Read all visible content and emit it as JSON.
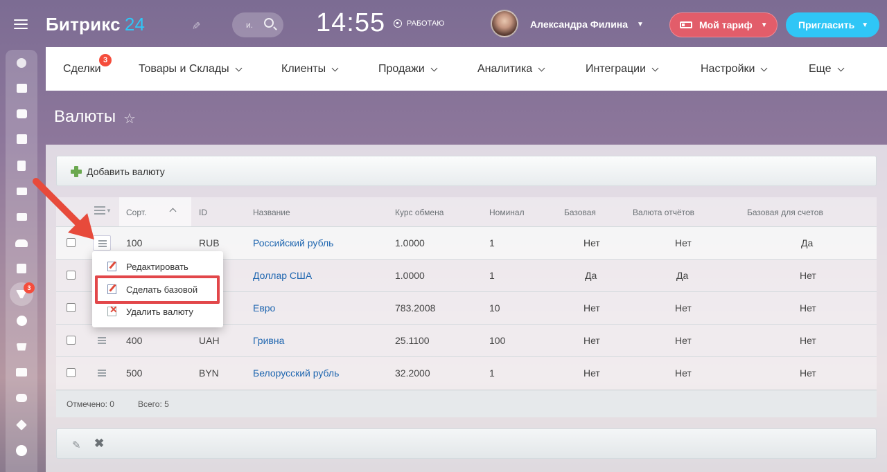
{
  "header": {
    "logo_text": "Битрикс",
    "logo_num": "24",
    "search_placeholder": "и.",
    "clock": "14:55",
    "work_status": "РАБОТАЮ",
    "user_name": "Александра Филина",
    "tariff_button": "Мой тариф",
    "invite_button": "Пригласить"
  },
  "left_rail": {
    "badge_filter": "3",
    "icons": [
      "pulse-icon",
      "feed-icon",
      "chat-icon",
      "calendar-icon",
      "docs-icon",
      "drive-icon",
      "mail-icon",
      "users-icon",
      "tasks-icon",
      "crm-filter-icon",
      "target-icon",
      "cart-icon",
      "contacts-icon",
      "robot-icon",
      "box-icon",
      "more-icon"
    ]
  },
  "nav": {
    "items": [
      {
        "label": "Сделки",
        "badge": "3"
      },
      {
        "label": "Товары и Склады"
      },
      {
        "label": "Клиенты"
      },
      {
        "label": "Продажи"
      },
      {
        "label": "Аналитика"
      },
      {
        "label": "Интеграции"
      },
      {
        "label": "Настройки"
      },
      {
        "label": "Еще"
      }
    ]
  },
  "page": {
    "title": "Валюты",
    "add_button": "Добавить валюту"
  },
  "table": {
    "columns": [
      "Сорт.",
      "ID",
      "Название",
      "Курс обмена",
      "Номинал",
      "Базовая",
      "Валюта отчётов",
      "Базовая для счетов"
    ],
    "rows": [
      {
        "sort": "100",
        "id": "RUB",
        "name": "Российский рубль",
        "rate": "1.0000",
        "nominal": "1",
        "base": "Нет",
        "report": "Нет",
        "invoice_base": "Да"
      },
      {
        "sort": "",
        "id": "",
        "name": "Доллар США",
        "rate": "1.0000",
        "nominal": "1",
        "base": "Да",
        "report": "Да",
        "invoice_base": "Нет"
      },
      {
        "sort": "",
        "id": "",
        "name": "Евро",
        "rate": "783.2008",
        "nominal": "10",
        "base": "Нет",
        "report": "Нет",
        "invoice_base": "Нет"
      },
      {
        "sort": "400",
        "id": "UAH",
        "name": "Гривна",
        "rate": "25.1100",
        "nominal": "100",
        "base": "Нет",
        "report": "Нет",
        "invoice_base": "Нет"
      },
      {
        "sort": "500",
        "id": "BYN",
        "name": "Белорусский рубль",
        "rate": "32.2000",
        "nominal": "1",
        "base": "Нет",
        "report": "Нет",
        "invoice_base": "Нет"
      }
    ],
    "footer_selected": "Отмечено: 0",
    "footer_total": "Всего: 5"
  },
  "context_menu": {
    "items": [
      "Редактировать",
      "Сделать базовой",
      "Удалить валюту"
    ]
  },
  "colors": {
    "accent": "#2fc6f6",
    "tariff": "#e25d6a",
    "highlight": "#e2474a",
    "link": "#2067b0"
  }
}
